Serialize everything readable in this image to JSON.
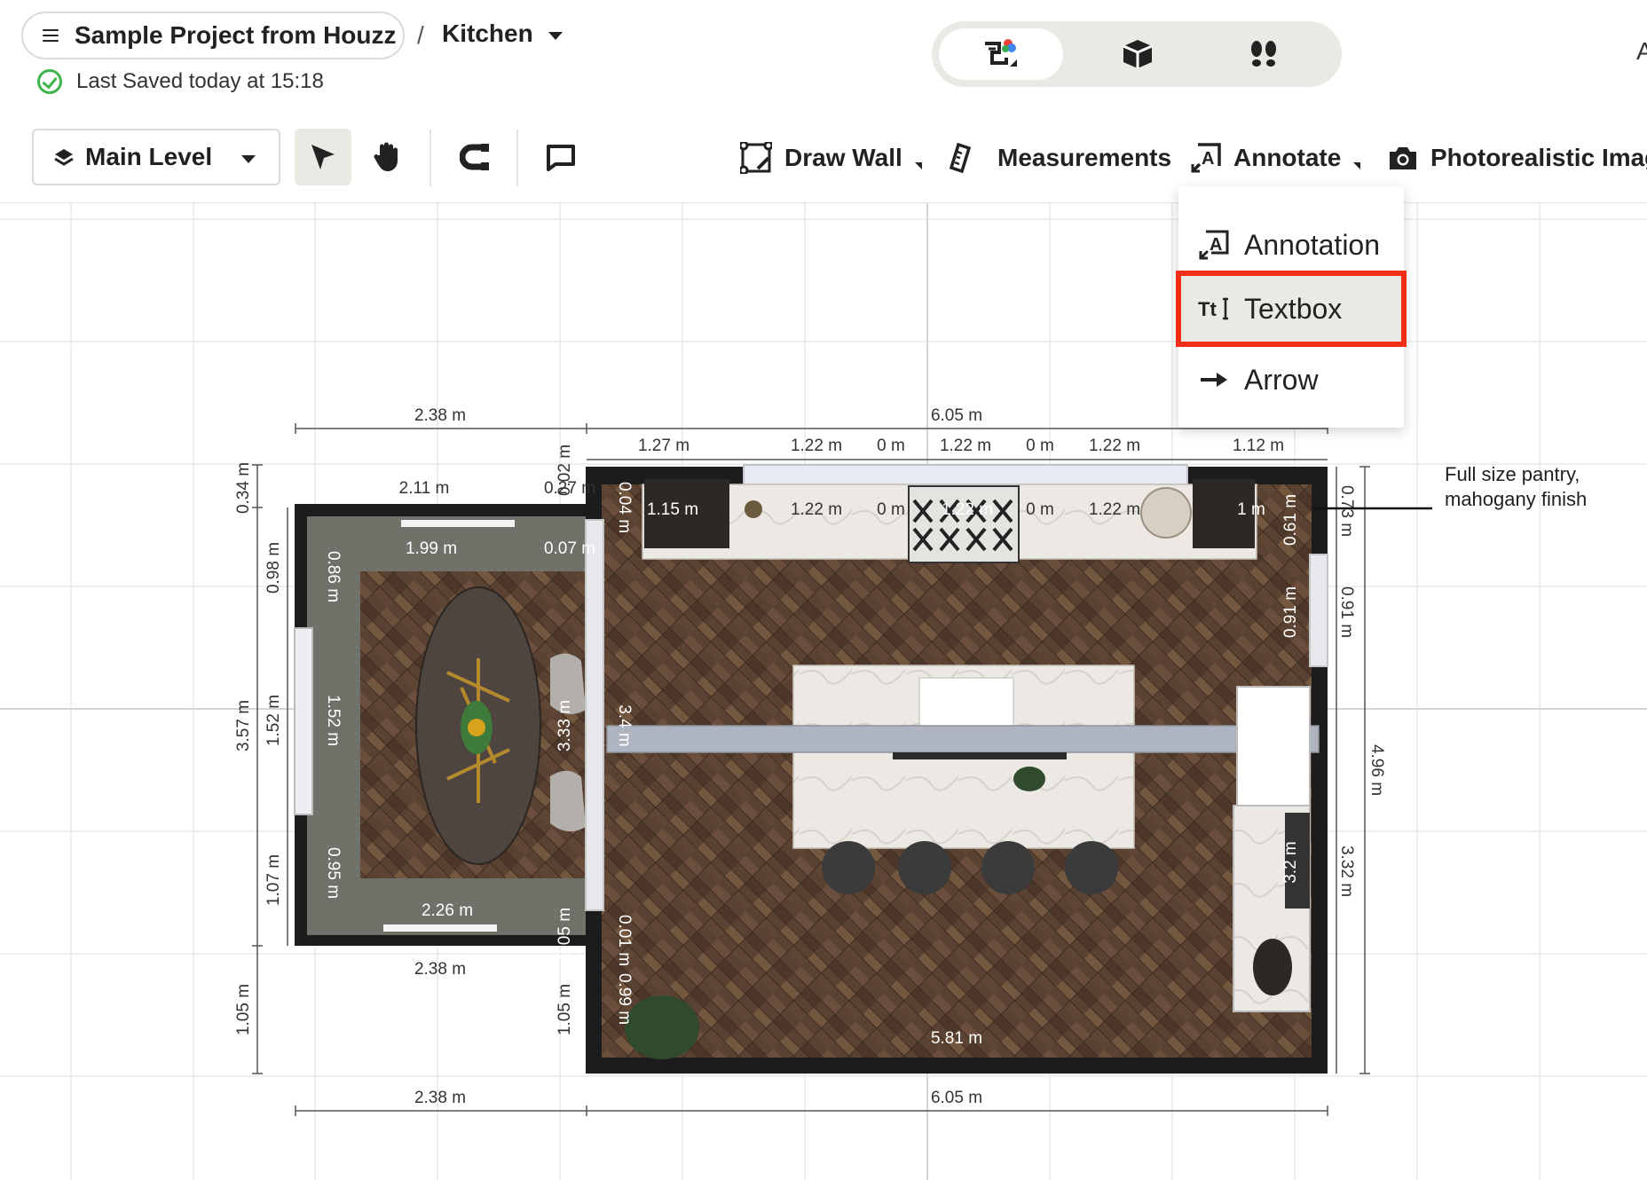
{
  "header": {
    "project_title": "Sample Project from Houzz",
    "breadcrumb_separator": "/",
    "room_name": "Kitchen",
    "saved_status": "Last Saved today at 15:18",
    "right_cut_text": "A",
    "view_modes": [
      "2d-floorplan-icon",
      "3d-box-icon",
      "walkthrough-footsteps-icon"
    ]
  },
  "toolbar": {
    "level": "Main Level",
    "draw_wall": "Draw Wall",
    "measurements": "Measurements",
    "annotate": "Annotate",
    "photorealistic": "Photorealistic Imag"
  },
  "annotate_menu": {
    "items": [
      {
        "label": "Annotation",
        "icon": "annotation-icon"
      },
      {
        "label": "Textbox",
        "icon": "textbox-icon",
        "highlighted": true
      },
      {
        "label": "Arrow",
        "icon": "arrow-icon"
      }
    ]
  },
  "floorplan": {
    "note": [
      "Full size pantry,",
      "mahogany finish"
    ],
    "dims": {
      "top_left_total": "2.38 m",
      "top_right_total": "6.05 m",
      "seg_127": "1.27 m",
      "seg_122a": "1.22 m",
      "seg_0a": "0 m",
      "seg_122b": "1.22 m",
      "seg_0b": "0 m",
      "seg_122c": "1.22 m",
      "seg_112": "1.12 m",
      "dining_top": "2.11 m",
      "dining_027": "0.27 m",
      "bench_199": "1.99 m",
      "d_007": "0.07 m",
      "d_002": "0.02 m",
      "d_004": "0.04 m",
      "cab_115": "1.15 m",
      "in_122a": "1.22 m",
      "in_0a": "0 m",
      "in_122b": "1.22 m",
      "in_0b": "0 m",
      "in_122c": "1.22 m",
      "in_1m": "1 m",
      "in_061": "0.61 m",
      "right_073": "0.73 m",
      "left_034": "0.34 m",
      "left_098": "0.98 m",
      "left_357": "3.57 m",
      "left_152": "1.52 m",
      "left_107": "1.07 m",
      "left_105": "1.05 m",
      "in_086": "0.86 m",
      "in_152": "1.52 m",
      "in_095": "0.95 m",
      "in_333": "3.33 m",
      "in_34": "3.4 m",
      "bench_226": "2.26 m",
      "dining_bottom": "2.38 m",
      "in_005": "0.05 m",
      "in_001": "0.01 m",
      "in_099": "0.99 m",
      "mid_105": "1.05 m",
      "in_091": "0.91 m",
      "right_091": "0.91 m",
      "right_496": "4.96 m",
      "right_332": "3.32 m",
      "in_32": "3.2 m",
      "floor_581": "5.81 m",
      "bottom_left": "2.38 m",
      "bottom_right": "6.05 m"
    }
  }
}
